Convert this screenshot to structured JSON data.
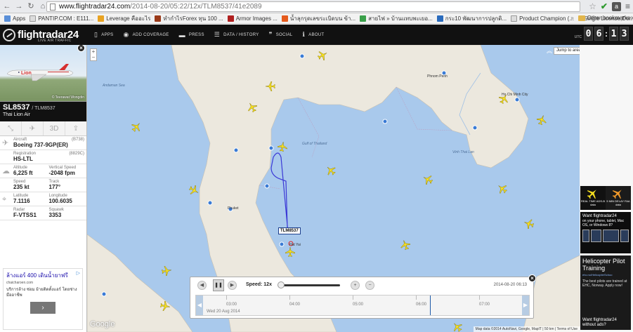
{
  "browser": {
    "url_host": "www.flightradar24.com",
    "url_path": "/2014-08-20/05:22/12x/TLM8537/41e2089",
    "bookmarks": [
      "Apps",
      "PANTIP.COM : E111...",
      "Leverage คืออะไร",
      "ทำกำไรForex ทุน 100 ...",
      "Armor Images ...",
      "น้ำลุกรุดเลขระเบิดบน ข้า...",
      "สายไฟ » บ้านแทบพะเยอ...",
      "กระ10 พัฒนาการปลูกดิ...",
      "Product Champion (...",
      "Single License,Deriv..."
    ],
    "other_bookmarks": "Other bookmarks",
    "more": "»"
  },
  "header": {
    "logo": "flightradar24",
    "logo_sub": "LIVE AIR TRAFFIC",
    "nav": [
      {
        "label": "APPS",
        "icon": "phone-icon"
      },
      {
        "label": "ADD COVERAGE",
        "icon": "eye-icon"
      },
      {
        "label": "PRESS",
        "icon": "press-icon"
      },
      {
        "label": "DATA / HISTORY",
        "icon": "database-icon"
      },
      {
        "label": "SOCIAL",
        "icon": "quote-icon"
      },
      {
        "label": "ABOUT",
        "icon": "info-icon"
      }
    ],
    "utc": "UTC",
    "clock": [
      "0",
      "6",
      "1",
      "3"
    ]
  },
  "flight": {
    "photo_credit": "© Teerawat Wongdin",
    "number": "SL8537",
    "callsign": "/ TLM8537",
    "airline": "Thai Lion Air",
    "tool_3d": "3D",
    "aircraft_label": "Aircraft",
    "aircraft_code": "(B738)",
    "aircraft": "Boeing 737-9GP(ER)",
    "registration_label": "Registration",
    "registration_code": "(8829C)",
    "registration": "HS-LTL",
    "altitude_label": "Altitude",
    "altitude": "6,225 ft",
    "vspeed_label": "Vertical Speed",
    "vspeed": "-2048 fpm",
    "speed_label": "Speed",
    "speed": "235 kt",
    "track_label": "Track",
    "track": "177°",
    "latitude_label": "Latitude",
    "latitude": "7.1116",
    "longitude_label": "Longitude",
    "longitude": "100.6035",
    "radar_label": "Radar",
    "radar": "F-VTSS1",
    "squawk_label": "Squawk",
    "squawk": "3353"
  },
  "left_ad": {
    "title": "ล้างแอร์ 400 เดินน้ำยาฟรี",
    "url": "chaicharoen.com",
    "body": "บริการล้าง ซ่อม ย้ายติดตั้งแอร์ โดยช่างมืออาชีพ",
    "button": "›"
  },
  "map": {
    "jump_to_area": "Jump to area",
    "map_type": "Map",
    "zoom_in": "+",
    "zoom_out": "−",
    "selected_callsign": "TLM8537",
    "google": "Google",
    "attribution": "Map data ©2014 AutoNavi, Google, MapIT  |  50 km  |  Terms of Use",
    "places": [
      {
        "name": "Phnom Penh"
      },
      {
        "name": "Ho Chi Minh City"
      },
      {
        "name": "Gulf of Thailand"
      },
      {
        "name": "Andaman Sea"
      },
      {
        "name": "Vinh Thai Lan"
      },
      {
        "name": "Hat Yai"
      },
      {
        "name": "Phuket"
      }
    ]
  },
  "playback": {
    "speed_label": "Speed: 12x",
    "datetime": "2014-08-20 06:13",
    "date": "Wed 20 Aug 2014",
    "times": [
      "03:00",
      "04:00",
      "05:00",
      "06:00",
      "07:00"
    ]
  },
  "right_ads": {
    "rt_left": "REAL TIME ADS-B data",
    "rt_right": "5 MIN DELAY FAA data",
    "app_title": "Want flightradar24",
    "app_body": "on your phone, tablet, Mac OS, or Windows 8?",
    "heli_title": "Helicopter Pilot Training",
    "heli_url": "ehc.no/HelicopterSchoo",
    "heli_body": "The best pilots are trained at EHC, Norway. Apply now!",
    "heli_footer": "Want flightradar24 without ads?"
  },
  "colors": {
    "map_sea": "#a9c9ec",
    "land": "#ece8de",
    "plane": "#f7e020",
    "track": "#3b38d6",
    "header": "#111111"
  }
}
